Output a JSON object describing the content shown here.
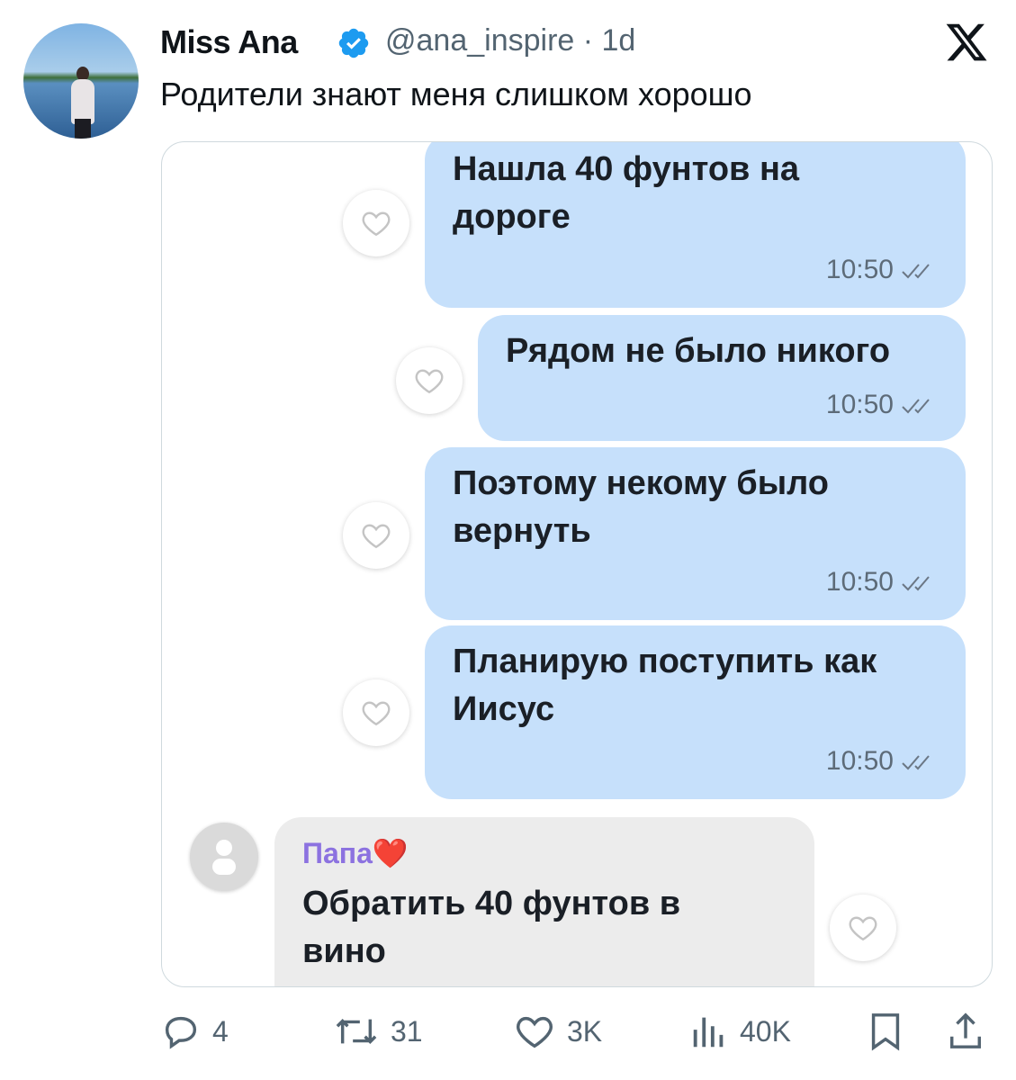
{
  "tweet": {
    "author_name": "Miss Ana",
    "handle": "@ana_inspire · 1d",
    "text": "Родители знают меня слишком хорошо"
  },
  "chat": {
    "messages": [
      {
        "lines": [
          "Нашла 40 фунтов на",
          "дороге"
        ],
        "time": "10:50"
      },
      {
        "lines": [
          "Рядом не было никого"
        ],
        "time": "10:50"
      },
      {
        "lines": [
          "Поэтому некому было",
          "вернуть"
        ],
        "time": "10:50"
      },
      {
        "lines": [
          "Планирую поступить как",
          "Иисус"
        ],
        "time": "10:50"
      }
    ],
    "reply": {
      "sender": "Папа❤️",
      "lines": [
        "Обратить 40 фунтов в",
        "вино"
      ]
    }
  },
  "actions": {
    "replies": "4",
    "retweets": "31",
    "likes": "3K",
    "views": "40K"
  },
  "colors": {
    "outgoing_bubble": "#c6e0fb",
    "incoming_bubble": "#ececec",
    "sender_name": "#8c72e0",
    "verified_badge": "#1d9bf0"
  },
  "icons": [
    "verified-icon",
    "x-logo-icon",
    "heart-icon",
    "read-checks-icon",
    "user-avatar-icon",
    "reply-icon",
    "retweet-icon",
    "like-icon",
    "views-icon",
    "bookmark-icon",
    "share-icon"
  ]
}
